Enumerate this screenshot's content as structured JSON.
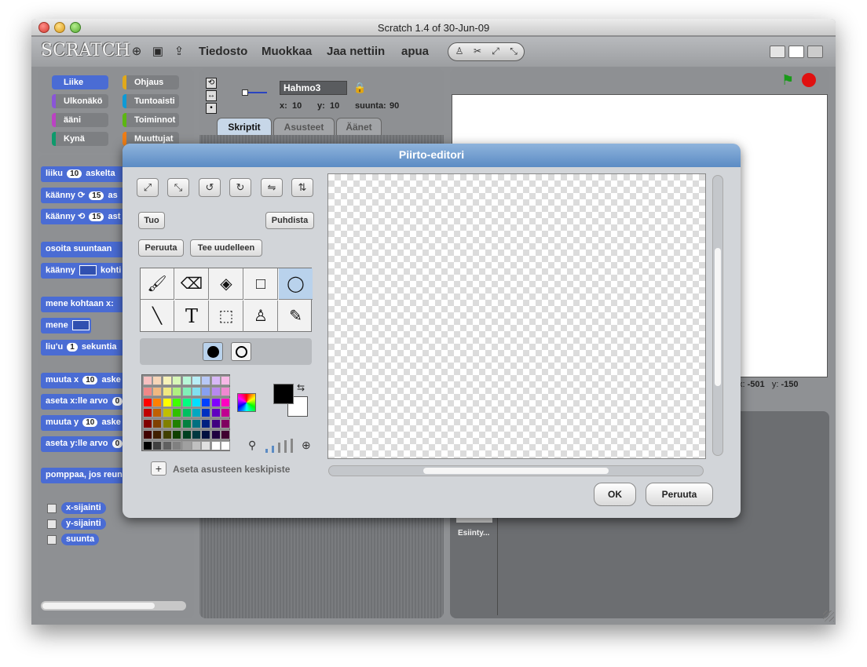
{
  "window": {
    "title": "Scratch 1.4 of 30-Jun-09"
  },
  "menubar": {
    "logo": "SCRATCH",
    "icons": [
      "globe-icon",
      "save-icon",
      "share-icon"
    ],
    "menus": [
      "Tiedosto",
      "Muokkaa",
      "Jaa nettiin",
      "apua"
    ],
    "tools": [
      "stamp-icon",
      "scissors-icon",
      "grow-icon",
      "shrink-icon"
    ]
  },
  "categories": [
    {
      "label": "Liike",
      "color": "#4a6cd4"
    },
    {
      "label": "Ohjaus",
      "color": "#e1a91a"
    },
    {
      "label": "Ulkonäkö",
      "color": "#8a55d7"
    },
    {
      "label": "Tuntoaisti",
      "color": "#0e9ad6"
    },
    {
      "label": "ääni",
      "color": "#bb42c3"
    },
    {
      "label": "Toiminnot",
      "color": "#5cb712"
    },
    {
      "label": "Kynä",
      "color": "#0e9a6c"
    },
    {
      "label": "Muuttujat",
      "color": "#ee7d16"
    }
  ],
  "blocks": {
    "move": {
      "pre": "liiku",
      "num": "10",
      "post": "askelta"
    },
    "turn_cw": {
      "pre": "käänny",
      "arrow": "⟳",
      "num": "15",
      "post": "as"
    },
    "turn_ccw": {
      "pre": "käänny",
      "arrow": "⟲",
      "num": "15",
      "post": "ast"
    },
    "point_dir": {
      "pre": "osoita suuntaan"
    },
    "point_towards": {
      "pre": "käänny",
      "post": "kohti"
    },
    "goto_xy": {
      "pre": "mene kohtaan x:"
    },
    "goto": {
      "pre": "mene"
    },
    "glide": {
      "pre": "liu'u",
      "num": "1",
      "post": "sekuntia"
    },
    "change_x": {
      "pre": "muuta x",
      "num": "10",
      "post": "aske"
    },
    "set_x": {
      "pre": "aseta x:lle arvo",
      "num": "0"
    },
    "change_y": {
      "pre": "muuta y",
      "num": "10",
      "post": "aske"
    },
    "set_y": {
      "pre": "aseta y:lle arvo",
      "num": "0"
    },
    "bounce": {
      "pre": "pomppaa, jos reun"
    }
  },
  "reporters": [
    "x-sijainti",
    "y-sijainti",
    "suunta"
  ],
  "sprite": {
    "name": "Hahmo3",
    "x_label": "x:",
    "x": "10",
    "y_label": "y:",
    "y": "10",
    "dir_label": "suunta:",
    "dir": "90"
  },
  "tabs": [
    "Skriptit",
    "Asusteet",
    "Äänet"
  ],
  "stage": {
    "mouse_x_label": "x:",
    "mouse_x": "-501",
    "mouse_y_label": "y:",
    "mouse_y": "-150",
    "stage_label": "Esiinty..."
  },
  "paint_editor": {
    "title": "Piirto-editori",
    "transform_icons": [
      "grow-icon",
      "shrink-icon",
      "rotate-left-icon",
      "rotate-right-icon",
      "flip-horizontal-icon",
      "flip-vertical-icon"
    ],
    "import_label": "Tuo",
    "clear_label": "Puhdista",
    "undo_label": "Peruuta",
    "redo_label": "Tee uudelleen",
    "tools": [
      {
        "name": "paintbrush-icon",
        "glyph": "🖌"
      },
      {
        "name": "eraser-icon",
        "glyph": "⌫"
      },
      {
        "name": "fill-bucket-icon",
        "glyph": "◈"
      },
      {
        "name": "rectangle-icon",
        "glyph": "□"
      },
      {
        "name": "ellipse-icon",
        "glyph": "◯"
      },
      {
        "name": "line-icon",
        "glyph": "╲"
      },
      {
        "name": "text-icon",
        "glyph": "T"
      },
      {
        "name": "select-icon",
        "glyph": "⬚"
      },
      {
        "name": "stamp-icon",
        "glyph": "♙"
      },
      {
        "name": "eyedropper-icon",
        "glyph": "✎"
      }
    ],
    "selected_tool": "ellipse-icon",
    "fill_modes": [
      "filled-ellipse-icon",
      "outline-ellipse-icon"
    ],
    "palette": [
      [
        "#f7c0c0",
        "#f7d6b8",
        "#f7f2b8",
        "#d8f7b8",
        "#b8f7d8",
        "#b8eef7",
        "#b8c8f7",
        "#d8b8f7",
        "#f7b8e6"
      ],
      [
        "#f08888",
        "#f0b880",
        "#f0e880",
        "#b0f080",
        "#80f0b8",
        "#80e0f0",
        "#88a0f0",
        "#b888f0",
        "#f088d0"
      ],
      [
        "#ff0000",
        "#ff8000",
        "#ffff00",
        "#40ff00",
        "#00ff80",
        "#00e0ff",
        "#0040ff",
        "#8000ff",
        "#ff00c0"
      ],
      [
        "#c00000",
        "#c06000",
        "#c0c000",
        "#30c000",
        "#00c060",
        "#00a8c0",
        "#0030c0",
        "#6000c0",
        "#c00090"
      ],
      [
        "#800000",
        "#804000",
        "#808000",
        "#208000",
        "#008040",
        "#007080",
        "#002080",
        "#400080",
        "#800060"
      ],
      [
        "#400000",
        "#402000",
        "#404000",
        "#104000",
        "#004020",
        "#003840",
        "#001040",
        "#200040",
        "#400030"
      ],
      [
        "#000000",
        "#404040",
        "#606060",
        "#808080",
        "#a0a0a0",
        "#c0c0c0",
        "#e0e0e0",
        "#ffffff",
        "#ffffff"
      ]
    ],
    "foreground_color": "#000000",
    "background_color": "#ffffff",
    "set_center_label": "Aseta asusteen keskipiste",
    "ok_label": "OK",
    "cancel_label": "Peruuta"
  }
}
